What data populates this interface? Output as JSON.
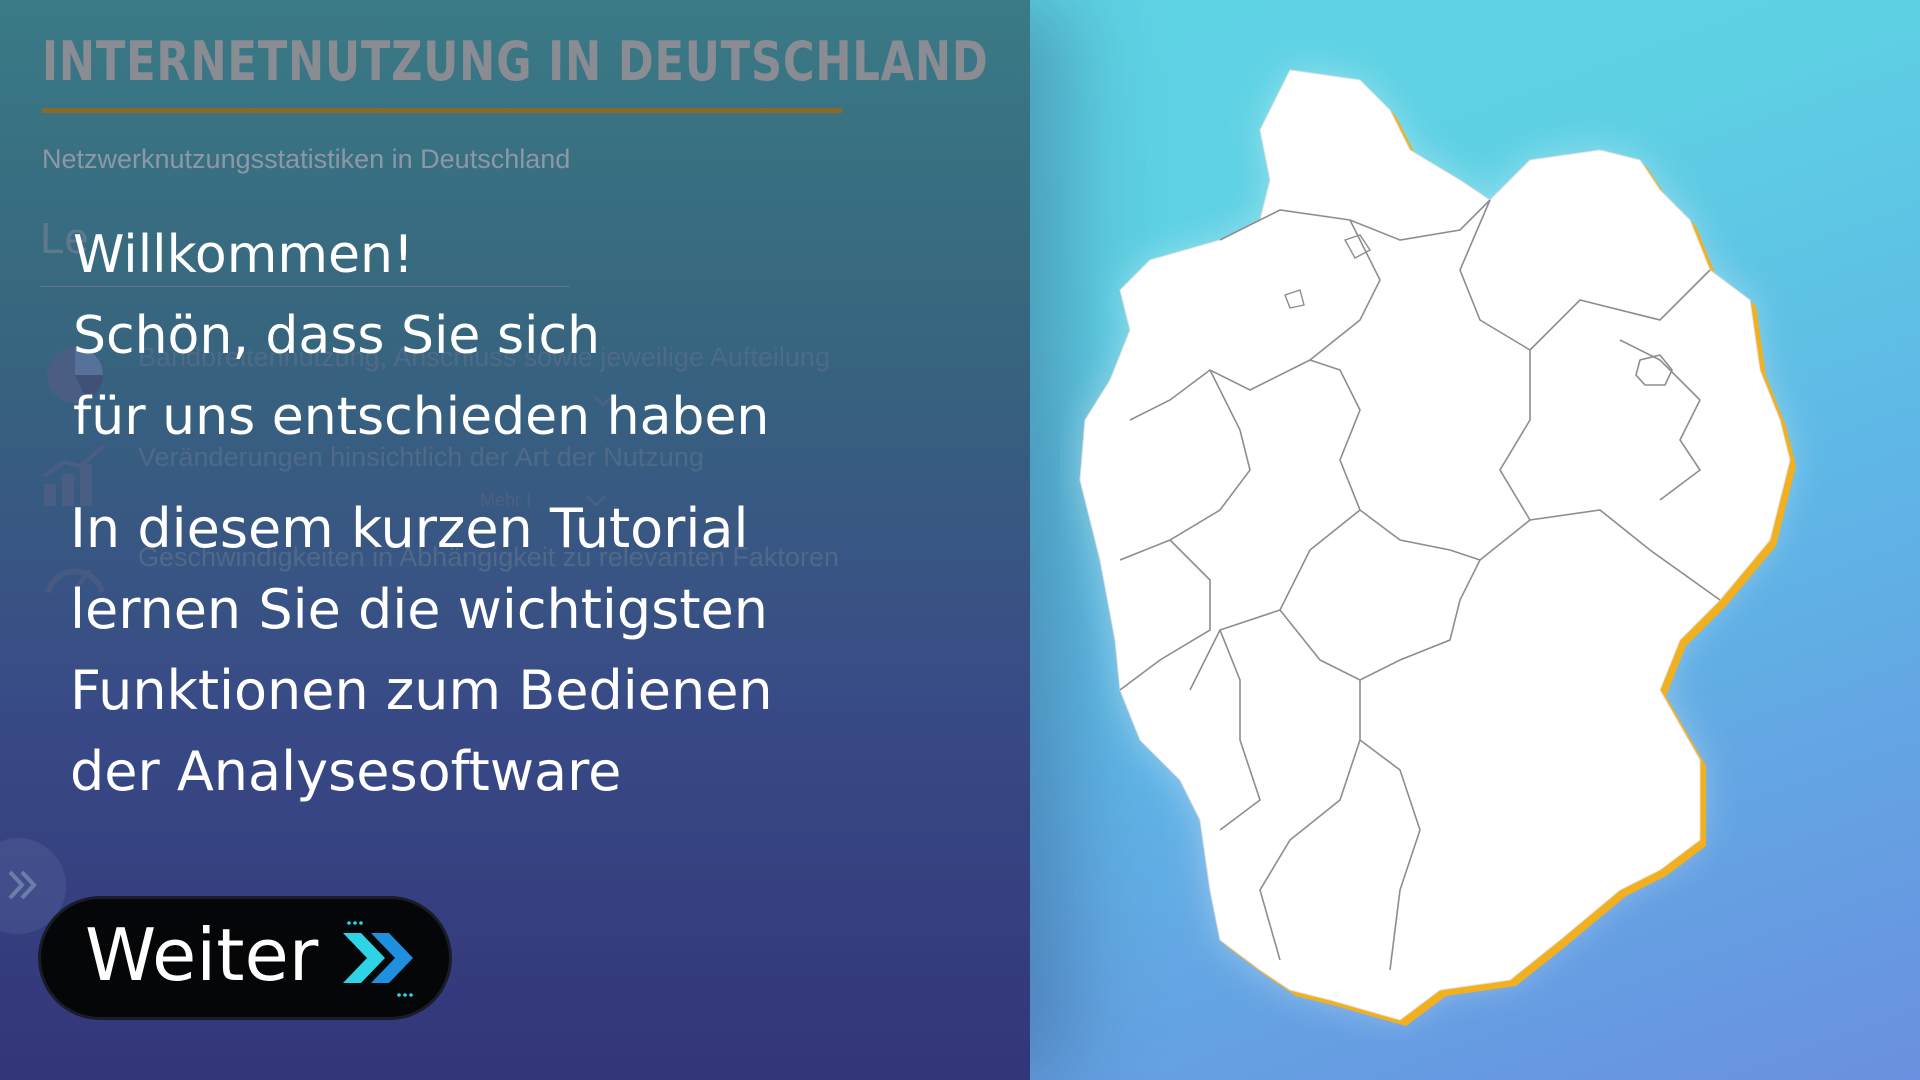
{
  "header": {
    "title": "INTERNETNUTZUNG IN DEUTSCHLAND",
    "subtitle": "Netzwerknutzungsstatistiken in Deutschland"
  },
  "background_menu": {
    "heading": "Le",
    "items": [
      {
        "label": "Bandbreitennutzung, Anschluss sowie jeweilige Aufteilung",
        "icon": "pie-chart-icon"
      },
      {
        "label": "Veränderungen hinsichtlich der Art der Nutzung",
        "icon": "bar-chart-icon"
      },
      {
        "label": "Geschwindigkeiten in Abhängigkeit zu relevanten Faktoren",
        "icon": "speedometer-icon"
      }
    ],
    "more_label": "Mehr I"
  },
  "welcome": {
    "lines": [
      "Willkommen!",
      "Schön, dass Sie sich",
      "für uns entschieden haben"
    ]
  },
  "tutorial": {
    "lines": [
      "In diesem kurzen Tutorial",
      "lernen Sie die wichtigsten",
      "Funktionen zum Bedienen",
      "der Analysesoftware"
    ]
  },
  "next_button": {
    "label": "Weiter",
    "icon": "double-chevron-right-icon"
  },
  "colors": {
    "accent_gold": "#f2b01e",
    "button_bg": "#050608",
    "chevron_cyan": "#2fd3e6",
    "chevron_blue": "#1f8fe0"
  },
  "map": {
    "icon": "germany-map"
  }
}
